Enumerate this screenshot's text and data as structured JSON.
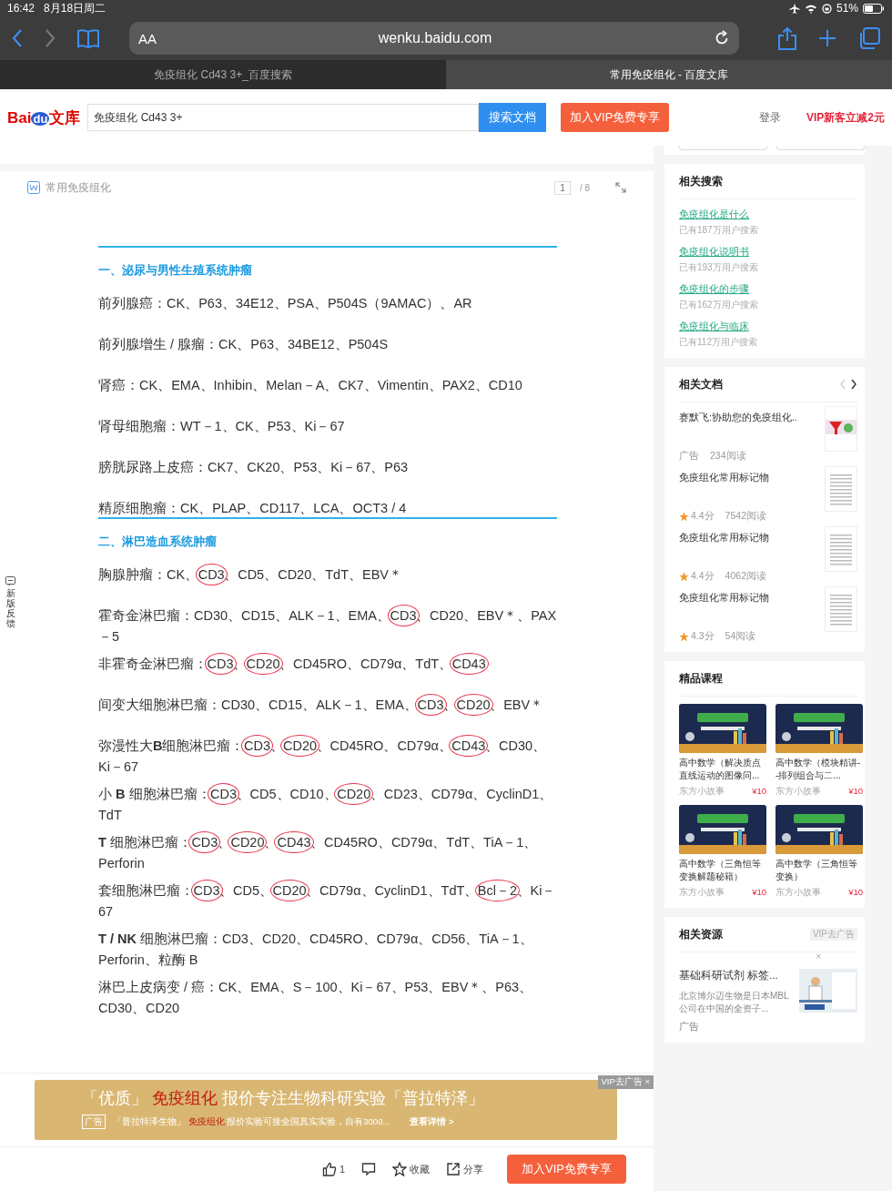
{
  "status_bar": {
    "time": "16:42",
    "date": "8月18日周二",
    "battery": "51%"
  },
  "browser": {
    "text_size": "AA",
    "url": "wenku.baidu.com",
    "tabs": [
      {
        "title": "免疫组化 Cd43 3+_百度搜索",
        "selected": false
      },
      {
        "title": "常用免疫组化 - 百度文库",
        "selected": true
      }
    ]
  },
  "site_header": {
    "logo": {
      "bai": "Bai",
      "du": "du",
      "wenku": "文库"
    },
    "search_value": "免疫组化 Cd43 3+",
    "search_button": "搜索文档",
    "vip_button": "加入VIP免费专享",
    "login": "登录",
    "promo": "VIP新客立减2元"
  },
  "feedback": "新版反馈",
  "document": {
    "title": "常用免疫组化",
    "page": "1",
    "pages": "/ 8",
    "blocks": [
      {
        "kind": "heading",
        "segments": [
          {
            "text": "一、泌尿与男性生殖系统肿瘤",
            "circled": false
          }
        ]
      },
      {
        "kind": "paragraph",
        "segments": [
          {
            "text": "前列腺癌：CK、P63、34E12、PSA、P504S（9AMAC）、AR",
            "circled": false
          }
        ]
      },
      {
        "kind": "paragraph",
        "segments": [
          {
            "text": "前列腺增生 / 腺瘤：CK、P63、34BE12、P504S",
            "circled": false
          }
        ]
      },
      {
        "kind": "paragraph",
        "segments": [
          {
            "text": "肾癌：CK、EMA、Inhibin、Melan－A、CK7、Vimentin、PAX2、CD10",
            "circled": false
          }
        ]
      },
      {
        "kind": "paragraph",
        "segments": [
          {
            "text": "肾母细胞瘤：WT－1、CK、P53、Ki－67",
            "circled": false
          }
        ]
      },
      {
        "kind": "paragraph",
        "segments": [
          {
            "text": "膀胱尿路上皮癌：CK7、CK20、P53、Ki－67、P63",
            "circled": false
          }
        ]
      },
      {
        "kind": "paragraph",
        "segments": [
          {
            "text": "精原细胞瘤：CK、PLAP、CD117、LCA、OCT3 / 4",
            "circled": false
          }
        ]
      },
      {
        "kind": "heading",
        "segments": [
          {
            "text": "二、淋巴造血系统肿瘤",
            "circled": false
          }
        ]
      },
      {
        "kind": "paragraph",
        "segments": [
          {
            "text": "胸腺肿瘤：CK、",
            "circled": false
          },
          {
            "text": "CD3",
            "circled": true
          },
          {
            "text": "、CD5、CD20、TdT、EBV＊",
            "circled": false
          }
        ]
      },
      {
        "kind": "paragraph",
        "segments": [
          {
            "text": "霍奇金淋巴瘤：CD30、CD15、ALK－1、EMA、",
            "circled": false
          },
          {
            "text": "CD3",
            "circled": true
          },
          {
            "text": "、CD20、EBV＊、PAX－5",
            "circled": false
          }
        ]
      },
      {
        "kind": "paragraph",
        "segments": [
          {
            "text": "非霍奇金淋巴瘤：",
            "circled": false
          },
          {
            "text": "CD3",
            "circled": true
          },
          {
            "text": "、",
            "circled": false
          },
          {
            "text": "CD20",
            "circled": true
          },
          {
            "text": "、CD45RO、CD79α、TdT、",
            "circled": false
          },
          {
            "text": "CD43",
            "circled": true
          }
        ]
      },
      {
        "kind": "paragraph",
        "segments": [
          {
            "text": "间变大细胞淋巴瘤：CD30、CD15、ALK－1、EMA、",
            "circled": false
          },
          {
            "text": "CD3",
            "circled": true
          },
          {
            "text": "、",
            "circled": false
          },
          {
            "text": "CD20",
            "circled": true
          },
          {
            "text": "、EBV＊",
            "circled": false
          }
        ]
      },
      {
        "kind": "paragraph",
        "segments": [
          {
            "text": "弥漫性大**B**细胞淋巴瘤：",
            "circled": false
          },
          {
            "text": "CD3",
            "circled": true
          },
          {
            "text": "、",
            "circled": false
          },
          {
            "text": "CD20",
            "circled": true
          },
          {
            "text": "、CD45RO、CD79α、",
            "circled": false
          },
          {
            "text": "CD43",
            "circled": true
          },
          {
            "text": "、CD30、Ki－67",
            "circled": false
          }
        ]
      },
      {
        "kind": "paragraph",
        "segments": [
          {
            "text": "小 **B** 细胞淋巴瘤：",
            "circled": false
          },
          {
            "text": "CD3",
            "circled": true
          },
          {
            "text": "、CD5、CD10、",
            "circled": false
          },
          {
            "text": "CD20",
            "circled": true
          },
          {
            "text": "、CD23、CD79α、CyclinD1、TdT",
            "circled": false
          }
        ]
      },
      {
        "kind": "paragraph",
        "segments": [
          {
            "text": "**T** 细胞淋巴瘤：",
            "circled": false
          },
          {
            "text": "CD3",
            "circled": true
          },
          {
            "text": "、",
            "circled": false
          },
          {
            "text": "CD20",
            "circled": true
          },
          {
            "text": "、",
            "circled": false
          },
          {
            "text": "CD43",
            "circled": true
          },
          {
            "text": "、CD45RO、CD79α、TdT、TiA－1、Perforin",
            "circled": false
          }
        ]
      },
      {
        "kind": "paragraph",
        "segments": [
          {
            "text": "套细胞淋巴瘤：",
            "circled": false
          },
          {
            "text": "CD3",
            "circled": true
          },
          {
            "text": "、CD5、",
            "circled": false
          },
          {
            "text": "CD20",
            "circled": true
          },
          {
            "text": "、CD79α、CyclinD1、TdT、",
            "circled": false
          },
          {
            "text": "Bcl－2",
            "circled": true
          },
          {
            "text": "、Ki－67",
            "circled": false
          }
        ]
      },
      {
        "kind": "paragraph",
        "segments": [
          {
            "text": "**T / NK** 细胞淋巴瘤：CD3、CD20、CD45RO、CD79α、CD56、TiA－1、Perforin、粒酶 B",
            "circled": false
          }
        ]
      },
      {
        "kind": "paragraph",
        "segments": [
          {
            "text": "淋巴上皮病变 / 癌：CK、EMA、S－100、Ki－67、P53、EBV＊、P63、CD30、CD20",
            "circled": false
          }
        ]
      }
    ]
  },
  "ad_banner": {
    "remove_ad": "VIP去广告 ×",
    "headline": [
      {
        "text": "「优质」",
        "highlight": false
      },
      {
        "text": "免疫组化",
        "highlight": true
      },
      {
        "text": "报价专注生物科研实验「普拉特泽」",
        "highlight": false
      }
    ],
    "tag": "广告",
    "subline": [
      {
        "text": "「普拉特泽生物」",
        "highlight": false
      },
      {
        "text": "免疫组化",
        "highlight": true
      },
      {
        "text": "报价实验可接全国真实实验，自有3000...",
        "highlight": false
      }
    ],
    "link": "查看详情 >"
  },
  "bottom_bar": {
    "likes": "1",
    "favorite": "收藏",
    "share": "分享",
    "vip_button": "加入VIP免费专享"
  },
  "related_searches": {
    "title": "相关搜索",
    "items": [
      {
        "query": "免疫组化是什么",
        "count": "已有187万用户搜索"
      },
      {
        "query": "免疫组化说明书",
        "count": "已有193万用户搜索"
      },
      {
        "query": "免疫组化的步骤",
        "count": "已有162万用户搜索"
      },
      {
        "query": "免疫组化与临床",
        "count": "已有112万用户搜索"
      }
    ]
  },
  "related_docs": {
    "title": "相关文档",
    "items": [
      {
        "kind": "ad",
        "title": "赛默飞:协助您的免疫组化..",
        "tag": "广告",
        "reads": "234阅读"
      },
      {
        "kind": "doc",
        "title": "免疫组化常用标记物",
        "rating": "4.4分",
        "reads": "7542阅读"
      },
      {
        "kind": "doc",
        "title": "免疫组化常用标记物",
        "rating": "4.4分",
        "reads": "4062阅读"
      },
      {
        "kind": "doc",
        "title": "免疫组化常用标记物",
        "rating": "4.3分",
        "reads": "54阅读"
      }
    ]
  },
  "courses": {
    "title": "精品课程",
    "items": [
      {
        "title": "高中数学（解决质点直线运动的图像问...",
        "author": "东方小故事",
        "price": "¥10"
      },
      {
        "title": "高中数学（模块精讲--排列组合与二...",
        "author": "东方小故事",
        "price": "¥10"
      },
      {
        "title": "高中数学（三角恒等变换解题秘籍）",
        "author": "东方小故事",
        "price": "¥10"
      },
      {
        "title": "高中数学（三角恒等变换）",
        "author": "东方小故事",
        "price": "¥10"
      }
    ]
  },
  "resources": {
    "title": "相关资源",
    "remove_ad": "VIP去广告",
    "close": "×",
    "item": {
      "title": "基础科研试剂 标签...",
      "desc": "北京博尔迈生物是日本MBL公司在中国的全资子...",
      "tag": "广告"
    }
  }
}
